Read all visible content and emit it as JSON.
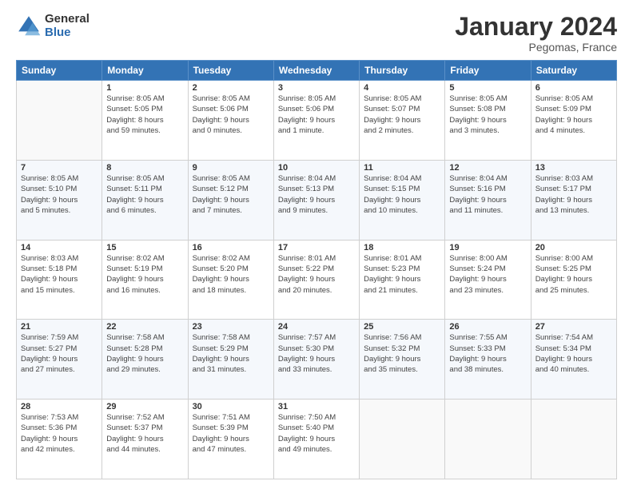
{
  "logo": {
    "general": "General",
    "blue": "Blue"
  },
  "title": "January 2024",
  "location": "Pegomas, France",
  "weekdays": [
    "Sunday",
    "Monday",
    "Tuesday",
    "Wednesday",
    "Thursday",
    "Friday",
    "Saturday"
  ],
  "weeks": [
    [
      {
        "day": "",
        "info": ""
      },
      {
        "day": "1",
        "info": "Sunrise: 8:05 AM\nSunset: 5:05 PM\nDaylight: 8 hours\nand 59 minutes."
      },
      {
        "day": "2",
        "info": "Sunrise: 8:05 AM\nSunset: 5:06 PM\nDaylight: 9 hours\nand 0 minutes."
      },
      {
        "day": "3",
        "info": "Sunrise: 8:05 AM\nSunset: 5:06 PM\nDaylight: 9 hours\nand 1 minute."
      },
      {
        "day": "4",
        "info": "Sunrise: 8:05 AM\nSunset: 5:07 PM\nDaylight: 9 hours\nand 2 minutes."
      },
      {
        "day": "5",
        "info": "Sunrise: 8:05 AM\nSunset: 5:08 PM\nDaylight: 9 hours\nand 3 minutes."
      },
      {
        "day": "6",
        "info": "Sunrise: 8:05 AM\nSunset: 5:09 PM\nDaylight: 9 hours\nand 4 minutes."
      }
    ],
    [
      {
        "day": "7",
        "info": "Sunrise: 8:05 AM\nSunset: 5:10 PM\nDaylight: 9 hours\nand 5 minutes."
      },
      {
        "day": "8",
        "info": "Sunrise: 8:05 AM\nSunset: 5:11 PM\nDaylight: 9 hours\nand 6 minutes."
      },
      {
        "day": "9",
        "info": "Sunrise: 8:05 AM\nSunset: 5:12 PM\nDaylight: 9 hours\nand 7 minutes."
      },
      {
        "day": "10",
        "info": "Sunrise: 8:04 AM\nSunset: 5:13 PM\nDaylight: 9 hours\nand 9 minutes."
      },
      {
        "day": "11",
        "info": "Sunrise: 8:04 AM\nSunset: 5:15 PM\nDaylight: 9 hours\nand 10 minutes."
      },
      {
        "day": "12",
        "info": "Sunrise: 8:04 AM\nSunset: 5:16 PM\nDaylight: 9 hours\nand 11 minutes."
      },
      {
        "day": "13",
        "info": "Sunrise: 8:03 AM\nSunset: 5:17 PM\nDaylight: 9 hours\nand 13 minutes."
      }
    ],
    [
      {
        "day": "14",
        "info": "Sunrise: 8:03 AM\nSunset: 5:18 PM\nDaylight: 9 hours\nand 15 minutes."
      },
      {
        "day": "15",
        "info": "Sunrise: 8:02 AM\nSunset: 5:19 PM\nDaylight: 9 hours\nand 16 minutes."
      },
      {
        "day": "16",
        "info": "Sunrise: 8:02 AM\nSunset: 5:20 PM\nDaylight: 9 hours\nand 18 minutes."
      },
      {
        "day": "17",
        "info": "Sunrise: 8:01 AM\nSunset: 5:22 PM\nDaylight: 9 hours\nand 20 minutes."
      },
      {
        "day": "18",
        "info": "Sunrise: 8:01 AM\nSunset: 5:23 PM\nDaylight: 9 hours\nand 21 minutes."
      },
      {
        "day": "19",
        "info": "Sunrise: 8:00 AM\nSunset: 5:24 PM\nDaylight: 9 hours\nand 23 minutes."
      },
      {
        "day": "20",
        "info": "Sunrise: 8:00 AM\nSunset: 5:25 PM\nDaylight: 9 hours\nand 25 minutes."
      }
    ],
    [
      {
        "day": "21",
        "info": "Sunrise: 7:59 AM\nSunset: 5:27 PM\nDaylight: 9 hours\nand 27 minutes."
      },
      {
        "day": "22",
        "info": "Sunrise: 7:58 AM\nSunset: 5:28 PM\nDaylight: 9 hours\nand 29 minutes."
      },
      {
        "day": "23",
        "info": "Sunrise: 7:58 AM\nSunset: 5:29 PM\nDaylight: 9 hours\nand 31 minutes."
      },
      {
        "day": "24",
        "info": "Sunrise: 7:57 AM\nSunset: 5:30 PM\nDaylight: 9 hours\nand 33 minutes."
      },
      {
        "day": "25",
        "info": "Sunrise: 7:56 AM\nSunset: 5:32 PM\nDaylight: 9 hours\nand 35 minutes."
      },
      {
        "day": "26",
        "info": "Sunrise: 7:55 AM\nSunset: 5:33 PM\nDaylight: 9 hours\nand 38 minutes."
      },
      {
        "day": "27",
        "info": "Sunrise: 7:54 AM\nSunset: 5:34 PM\nDaylight: 9 hours\nand 40 minutes."
      }
    ],
    [
      {
        "day": "28",
        "info": "Sunrise: 7:53 AM\nSunset: 5:36 PM\nDaylight: 9 hours\nand 42 minutes."
      },
      {
        "day": "29",
        "info": "Sunrise: 7:52 AM\nSunset: 5:37 PM\nDaylight: 9 hours\nand 44 minutes."
      },
      {
        "day": "30",
        "info": "Sunrise: 7:51 AM\nSunset: 5:39 PM\nDaylight: 9 hours\nand 47 minutes."
      },
      {
        "day": "31",
        "info": "Sunrise: 7:50 AM\nSunset: 5:40 PM\nDaylight: 9 hours\nand 49 minutes."
      },
      {
        "day": "",
        "info": ""
      },
      {
        "day": "",
        "info": ""
      },
      {
        "day": "",
        "info": ""
      }
    ]
  ]
}
